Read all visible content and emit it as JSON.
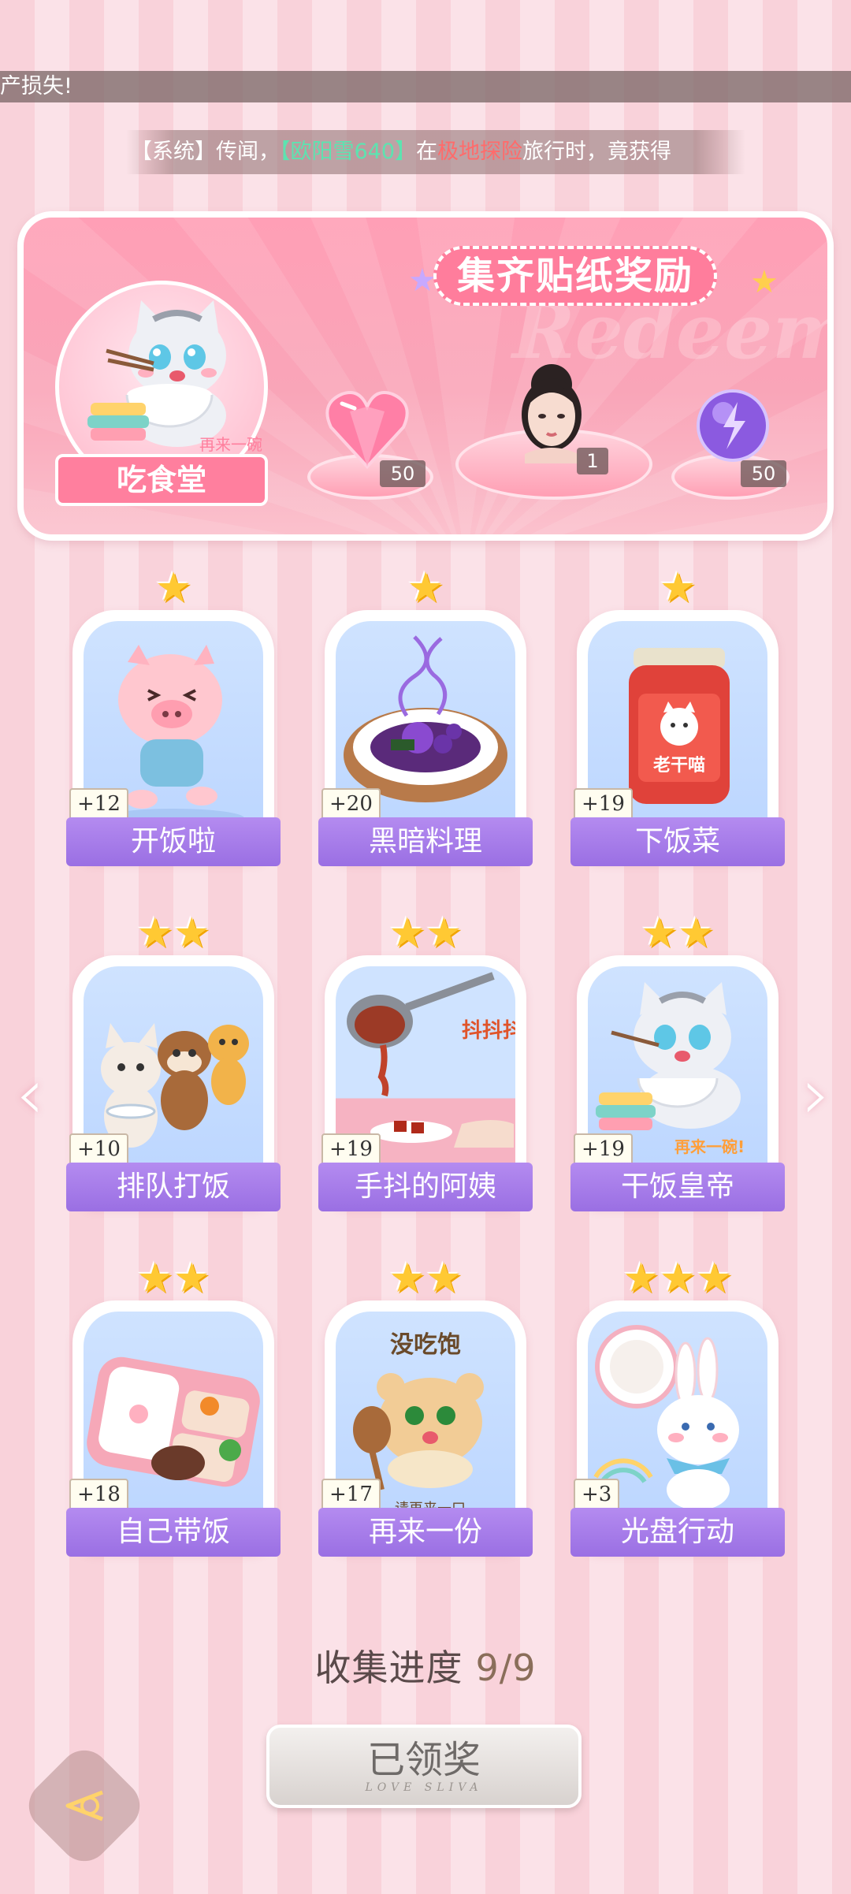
{
  "ticker_top": {
    "text": "产损失!"
  },
  "system_ticker": {
    "prefix": "【系统】传闻，",
    "player": "【欧阳雪640】",
    "mid": "在",
    "place": "极地探险",
    "suffix": "旅行时，竟获得"
  },
  "banner": {
    "title": "集齐贴纸奖励",
    "watermark": "Redeem",
    "sticker_label": "吃食堂",
    "sticker_caption": "再来一碗!",
    "rewards": [
      {
        "icon": "pink-heart-gem-icon",
        "count": "50"
      },
      {
        "icon": "character-portrait-icon",
        "count": "1"
      },
      {
        "icon": "purple-energy-orb-icon",
        "count": "50"
      }
    ]
  },
  "cards": [
    {
      "label": "开饭啦",
      "count": "+12",
      "stars": "★",
      "art": "pig-running"
    },
    {
      "label": "黑暗料理",
      "count": "+20",
      "stars": "★",
      "art": "dark-dish"
    },
    {
      "label": "下饭菜",
      "count": "+19",
      "stars": "★",
      "art": "chili-jar",
      "jar_text": "老干喵"
    },
    {
      "label": "排队打饭",
      "count": "+10",
      "stars": "★★",
      "art": "animals-queue"
    },
    {
      "label": "手抖的阿姨",
      "count": "+19",
      "stars": "★★",
      "art": "ladle-pour",
      "side_text": "抖抖抖!"
    },
    {
      "label": "干饭皇帝",
      "count": "+19",
      "stars": "★★",
      "art": "cat-eating",
      "side_text": "再来一碗!"
    },
    {
      "label": "自己带饭",
      "count": "+18",
      "stars": "★★",
      "art": "bento-box"
    },
    {
      "label": "再来一份",
      "count": "+17",
      "stars": "★★",
      "art": "hamster-spoon",
      "top_text": "没吃饱",
      "bottom_text": "请再来一口"
    },
    {
      "label": "光盘行动",
      "count": "+3",
      "stars": "★★★",
      "art": "bunny-plate"
    }
  ],
  "progress": {
    "label": "收集进度",
    "value": "9/9"
  },
  "claim_button": {
    "label": "已领奖",
    "sub": "LOVE SLIVA"
  },
  "colors": {
    "accent": "#ff7d9c",
    "card_label": "#9a6fe3",
    "star": "#ffc933"
  }
}
